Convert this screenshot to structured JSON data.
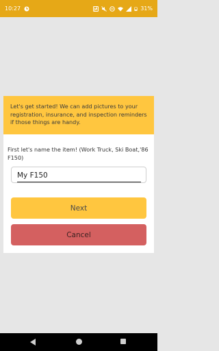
{
  "status_bar": {
    "time": "10:27",
    "battery": "31%",
    "icons": [
      "notification-icon",
      "nfc-icon",
      "mute-icon",
      "do-not-disturb-icon",
      "wifi-icon",
      "signal-icon",
      "battery-icon"
    ]
  },
  "dialog": {
    "banner_text": "Let's get started! We can add pictures to your registration, insurance, and inspection reminders if those things are handy.",
    "prompt": "First let's name the item! (Work Truck, Ski Boat,'86 F150)",
    "name_input": {
      "value": "My F150"
    },
    "next_label": "Next",
    "cancel_label": "Cancel"
  },
  "colors": {
    "status_bar": "#e6a817",
    "accent": "#ffc63f",
    "cancel": "#d46060"
  }
}
